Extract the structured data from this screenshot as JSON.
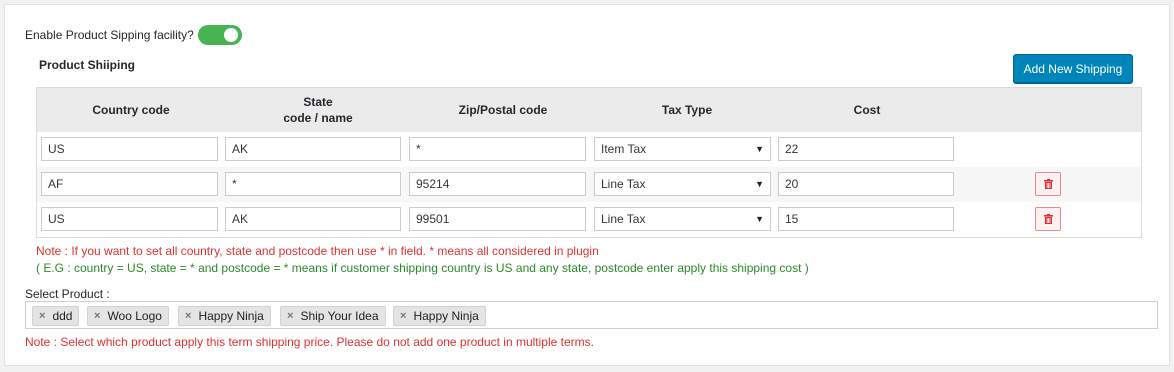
{
  "enable": {
    "label": "Enable Product Sipping facility?",
    "enabled": true,
    "color": "#46b450"
  },
  "section_title": "Product Shiiping",
  "add_button": {
    "label": "Add New Shipping",
    "color": "#0085ba"
  },
  "table": {
    "headers": {
      "country": "Country code",
      "state_line1": "State",
      "state_line2": "code / name",
      "zip": "Zip/Postal code",
      "tax": "Tax Type",
      "cost": "Cost"
    },
    "rows": [
      {
        "country": "US",
        "state": "AK",
        "zip": "*",
        "tax": "Item Tax",
        "cost": "22",
        "deletable": false
      },
      {
        "country": "AF",
        "state": "*",
        "zip": "95214",
        "tax": "Line Tax",
        "cost": "20",
        "deletable": true
      },
      {
        "country": "US",
        "state": "AK",
        "zip": "99501",
        "tax": "Line Tax",
        "cost": "15",
        "deletable": true
      }
    ]
  },
  "notes": {
    "note1": "Note : If you want to set all country, state and postcode then use * in field. * means all considered in plugin",
    "note2": "( E.G : country = US, state = * and postcode = * means if customer shipping country is US and any state, postcode enter apply this shipping cost )",
    "note3": "Note : Select which product apply this term shipping price. Please do not add one product in multiple terms."
  },
  "select_product": {
    "label": "Select Product :",
    "tags": [
      "ddd",
      "Woo Logo",
      "Happy Ninja",
      "Ship Your Idea",
      "Happy Ninja"
    ]
  },
  "icons": {
    "delete": "trash-icon",
    "remove_tag": "close-icon",
    "select_caret": "caret-down-icon"
  }
}
